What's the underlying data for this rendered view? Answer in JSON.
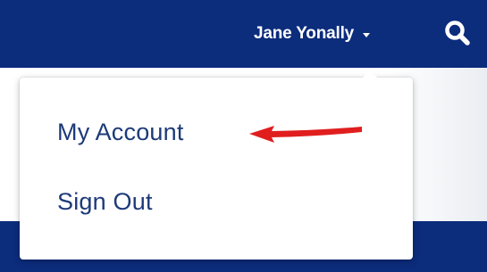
{
  "header": {
    "user_name": "Jane Yonally",
    "user_menu_icon": "caret-down-icon",
    "search_icon": "search-icon"
  },
  "menu": {
    "items": [
      {
        "label": "My Account"
      },
      {
        "label": "Sign Out"
      }
    ]
  },
  "annotation": {
    "icon": "red-arrow-icon",
    "points_to": "My Account"
  },
  "colors": {
    "navy": "#0c2c7c",
    "menu_text": "#1d3a78",
    "arrow": "#e01e1e",
    "white": "#ffffff"
  }
}
